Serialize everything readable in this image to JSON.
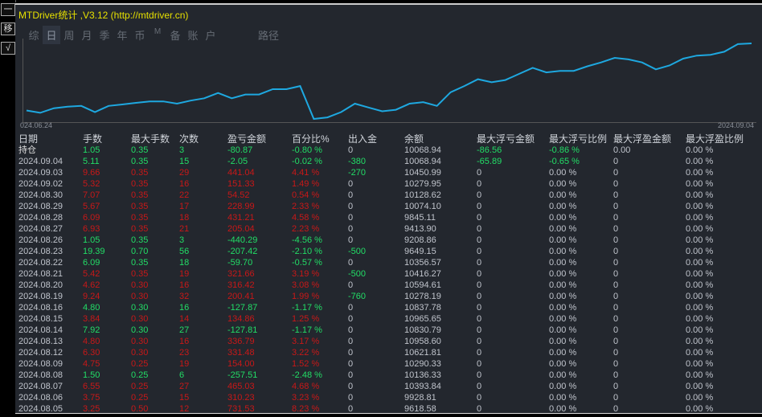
{
  "window": {
    "title": "MTDriver统计 ,V3.12 (http://mtdriver.cn)"
  },
  "side_buttons": [
    {
      "label": "一",
      "icon": "minimize-icon"
    },
    {
      "label": "移",
      "icon": "move-icon"
    },
    {
      "label": "√",
      "icon": "check-icon"
    }
  ],
  "tabs": [
    {
      "label": "综"
    },
    {
      "label": "日",
      "active": true
    },
    {
      "label": "周"
    },
    {
      "label": "月"
    },
    {
      "label": "季"
    },
    {
      "label": "年"
    },
    {
      "label": "币"
    },
    {
      "label": "M"
    },
    {
      "label": "备"
    },
    {
      "label": "账"
    },
    {
      "label": "户"
    }
  ],
  "path_label": "路径",
  "colors": {
    "background": "#23272e",
    "line": "#1ea8e0",
    "positive": "#22dd66",
    "negative": "#c81818",
    "title": "#e6e000"
  },
  "chart_data": {
    "type": "line",
    "x_start_label": "024.06.24",
    "x_end_label": "2024.09.04",
    "grid": false,
    "values": [
      11,
      8,
      14,
      16,
      17,
      9,
      17,
      19,
      21,
      23,
      23,
      20,
      24,
      27,
      34,
      27,
      32,
      32,
      39,
      39,
      43,
      0,
      2,
      9,
      20,
      15,
      10,
      12,
      20,
      22,
      17,
      35,
      43,
      52,
      48,
      51,
      59,
      67,
      61,
      63,
      63,
      69,
      74,
      80,
      78,
      74,
      65,
      70,
      79,
      83,
      84,
      88,
      98,
      99
    ]
  },
  "table": {
    "headers": [
      "日期",
      "手数",
      "最大手数",
      "次数",
      "盈亏金额",
      "百分比%",
      "出入金",
      "余额",
      "最大浮亏金额",
      "最大浮亏比例",
      "最大浮盈金额",
      "最大浮盈比例"
    ],
    "rows": [
      [
        "持仓",
        "1.05",
        "0.35",
        "3",
        "-80.87",
        "-0.80 %",
        "0",
        "10068.94",
        "-86.56",
        "-0.86 %",
        "0.00",
        "0.00 %"
      ],
      [
        "2024.09.04",
        "5.11",
        "0.35",
        "15",
        "-2.05",
        "-0.02 %",
        "-380",
        "10068.94",
        "-65.89",
        "-0.65 %",
        "0",
        "0.00 %"
      ],
      [
        "2024.09.03",
        "9.66",
        "0.35",
        "29",
        "441.04",
        "4.41 %",
        "-270",
        "10450.99",
        "0",
        "0.00 %",
        "0",
        "0.00 %"
      ],
      [
        "2024.09.02",
        "5.32",
        "0.35",
        "16",
        "151.33",
        "1.49 %",
        "0",
        "10279.95",
        "0",
        "0.00 %",
        "0",
        "0.00 %"
      ],
      [
        "2024.08.30",
        "7.07",
        "0.35",
        "22",
        "54.52",
        "0.54 %",
        "0",
        "10128.62",
        "0",
        "0.00 %",
        "0",
        "0.00 %"
      ],
      [
        "2024.08.29",
        "5.67",
        "0.35",
        "17",
        "228.99",
        "2.33 %",
        "0",
        "10074.10",
        "0",
        "0.00 %",
        "0",
        "0.00 %"
      ],
      [
        "2024.08.28",
        "6.09",
        "0.35",
        "18",
        "431.21",
        "4.58 %",
        "0",
        "9845.11",
        "0",
        "0.00 %",
        "0",
        "0.00 %"
      ],
      [
        "2024.08.27",
        "6.93",
        "0.35",
        "21",
        "205.04",
        "2.23 %",
        "0",
        "9413.90",
        "0",
        "0.00 %",
        "0",
        "0.00 %"
      ],
      [
        "2024.08.26",
        "1.05",
        "0.35",
        "3",
        "-440.29",
        "-4.56 %",
        "0",
        "9208.86",
        "0",
        "0.00 %",
        "0",
        "0.00 %"
      ],
      [
        "2024.08.23",
        "19.39",
        "0.70",
        "56",
        "-207.42",
        "-2.10 %",
        "-500",
        "9649.15",
        "0",
        "0.00 %",
        "0",
        "0.00 %"
      ],
      [
        "2024.08.22",
        "6.09",
        "0.35",
        "18",
        "-59.70",
        "-0.57 %",
        "0",
        "10356.57",
        "0",
        "0.00 %",
        "0",
        "0.00 %"
      ],
      [
        "2024.08.21",
        "5.42",
        "0.35",
        "19",
        "321.66",
        "3.19 %",
        "-500",
        "10416.27",
        "0",
        "0.00 %",
        "0",
        "0.00 %"
      ],
      [
        "2024.08.20",
        "4.62",
        "0.30",
        "16",
        "316.42",
        "3.08 %",
        "0",
        "10594.61",
        "0",
        "0.00 %",
        "0",
        "0.00 %"
      ],
      [
        "2024.08.19",
        "9.24",
        "0.30",
        "32",
        "200.41",
        "1.99 %",
        "-760",
        "10278.19",
        "0",
        "0.00 %",
        "0",
        "0.00 %"
      ],
      [
        "2024.08.16",
        "4.80",
        "0.30",
        "16",
        "-127.87",
        "-1.17 %",
        "0",
        "10837.78",
        "0",
        "0.00 %",
        "0",
        "0.00 %"
      ],
      [
        "2024.08.15",
        "3.84",
        "0.30",
        "14",
        "134.86",
        "1.25 %",
        "0",
        "10965.65",
        "0",
        "0.00 %",
        "0",
        "0.00 %"
      ],
      [
        "2024.08.14",
        "7.92",
        "0.30",
        "27",
        "-127.81",
        "-1.17 %",
        "0",
        "10830.79",
        "0",
        "0.00 %",
        "0",
        "0.00 %"
      ],
      [
        "2024.08.13",
        "4.80",
        "0.30",
        "16",
        "336.79",
        "3.17 %",
        "0",
        "10958.60",
        "0",
        "0.00 %",
        "0",
        "0.00 %"
      ],
      [
        "2024.08.12",
        "6.30",
        "0.30",
        "23",
        "331.48",
        "3.22 %",
        "0",
        "10621.81",
        "0",
        "0.00 %",
        "0",
        "0.00 %"
      ],
      [
        "2024.08.09",
        "4.75",
        "0.25",
        "19",
        "154.00",
        "1.52 %",
        "0",
        "10290.33",
        "0",
        "0.00 %",
        "0",
        "0.00 %"
      ],
      [
        "2024.08.08",
        "1.50",
        "0.25",
        "6",
        "-257.51",
        "-2.48 %",
        "0",
        "10136.33",
        "0",
        "0.00 %",
        "0",
        "0.00 %"
      ],
      [
        "2024.08.07",
        "6.55",
        "0.25",
        "27",
        "465.03",
        "4.68 %",
        "0",
        "10393.84",
        "0",
        "0.00 %",
        "0",
        "0.00 %"
      ],
      [
        "2024.08.06",
        "3.75",
        "0.25",
        "15",
        "310.23",
        "3.23 %",
        "0",
        "9928.81",
        "0",
        "0.00 %",
        "0",
        "0.00 %"
      ],
      [
        "2024.08.05",
        "3.25",
        "0.50",
        "12",
        "731.53",
        "8.23 %",
        "0",
        "9618.58",
        "0",
        "0.00 %",
        "0",
        "0.00 %"
      ]
    ]
  }
}
